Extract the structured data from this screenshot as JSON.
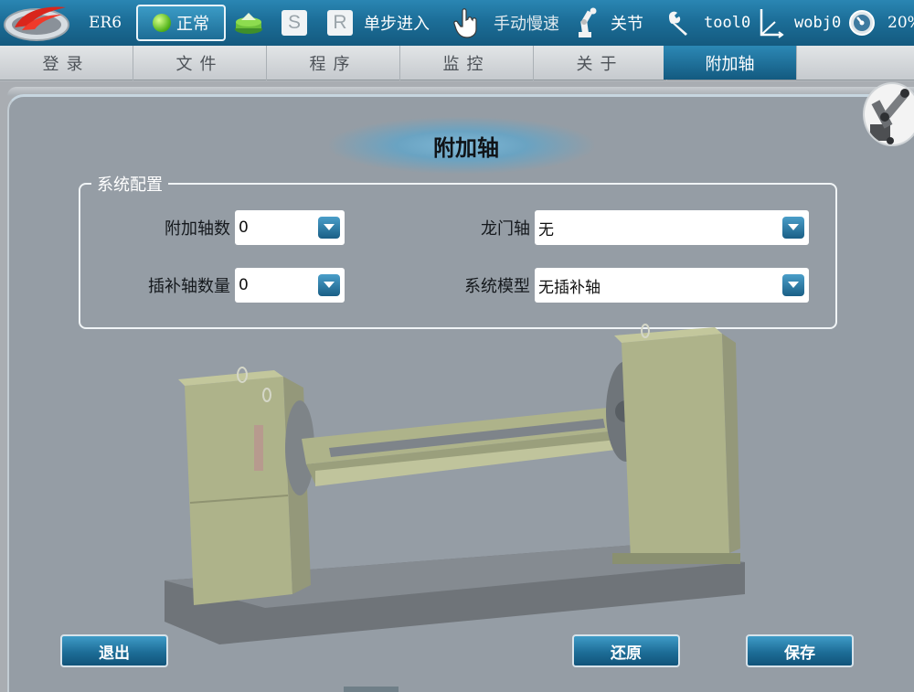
{
  "status_bar": {
    "robot_name": "ER6",
    "state": "正常",
    "s_label": "S",
    "r_label": "R",
    "step_mode": "单步进入",
    "speed_mode": "手动慢速",
    "coord_mode": "关节",
    "tool": "tool0",
    "wobj": "wobj0",
    "speed_percent": "20%",
    "state_color": "#55b51d"
  },
  "menu": {
    "items": [
      {
        "label": "登录",
        "active": false
      },
      {
        "label": "文件",
        "active": false
      },
      {
        "label": "程序",
        "active": false
      },
      {
        "label": "监控",
        "active": false
      },
      {
        "label": "关于",
        "active": false
      },
      {
        "label": "附加轴",
        "active": true
      }
    ]
  },
  "page": {
    "title": "附加轴",
    "group_title": "系统配置",
    "fields": {
      "extra_axis_count": {
        "label": "附加轴数",
        "value": "0"
      },
      "gantry_axis": {
        "label": "龙门轴",
        "value": "无"
      },
      "interp_axis_count": {
        "label": "插补轴数量",
        "value": "0"
      },
      "system_model": {
        "label": "系统模型",
        "value": "无插补轴"
      }
    }
  },
  "buttons": {
    "exit": "退出",
    "restore": "还原",
    "save": "保存"
  },
  "icons": {
    "logo": "company-logo",
    "stack": "stack-layers-icon",
    "hand": "hand-pointer-icon",
    "arm": "robot-arm-icon",
    "wrench": "wrench-icon",
    "axes": "coordinate-axes-icon",
    "gauge": "speed-gauge-icon",
    "dropdown": "chevron-down-icon"
  },
  "colors": {
    "accent": "#1c6e98",
    "panel": "#959da5"
  }
}
